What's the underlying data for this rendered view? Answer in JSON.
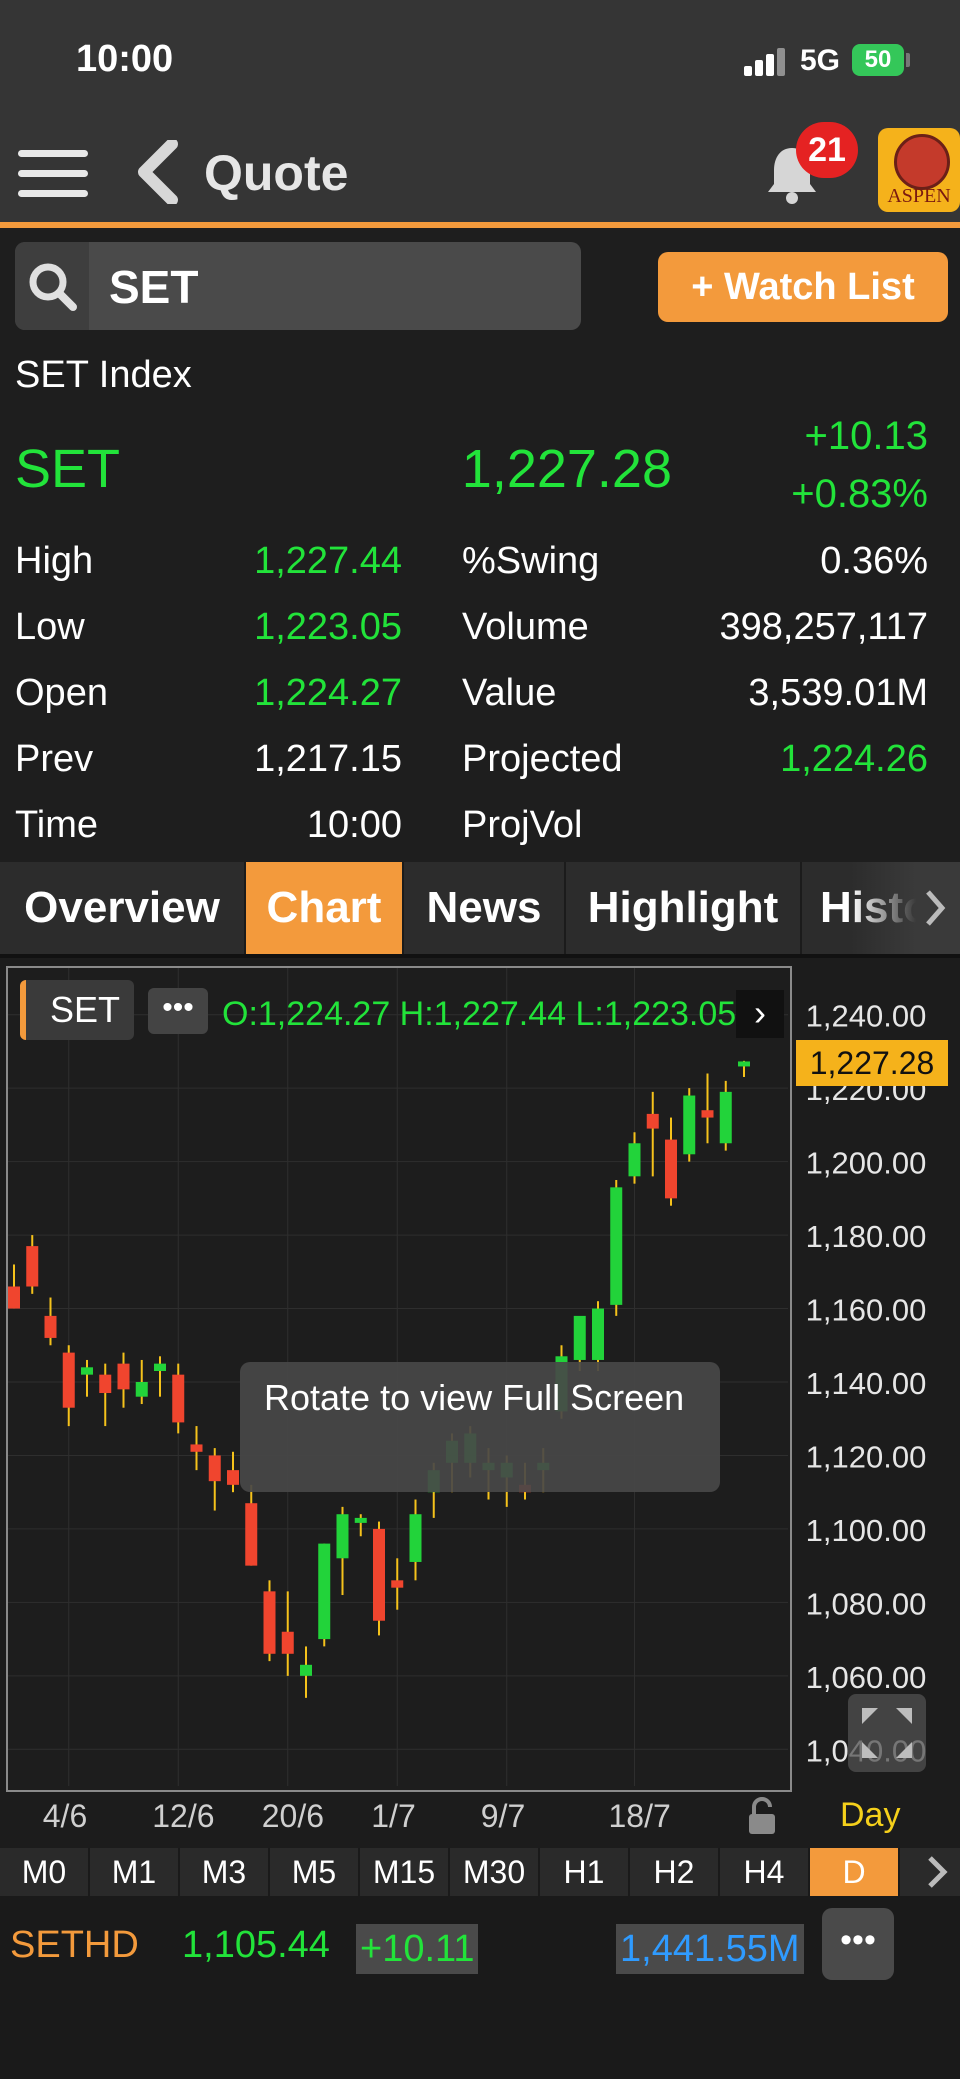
{
  "status_bar": {
    "time": "10:00",
    "network": "5G",
    "battery": "50"
  },
  "header": {
    "title": "Quote",
    "notification_count": "21",
    "logo_text": "ASPEN"
  },
  "search": {
    "value": "SET",
    "placeholder": ""
  },
  "watchlist_button": "+ Watch List",
  "quote": {
    "name": "SET Index",
    "symbol": "SET",
    "last": "1,227.28",
    "change": "+10.13",
    "change_pct": "+0.83%",
    "left_stats": [
      {
        "label": "High",
        "value": "1,227.44",
        "color": "green"
      },
      {
        "label": "Low",
        "value": "1,223.05",
        "color": "green"
      },
      {
        "label": "Open",
        "value": "1,224.27",
        "color": "green"
      },
      {
        "label": "Prev",
        "value": "1,217.15",
        "color": "white"
      },
      {
        "label": "Time",
        "value": "10:00",
        "color": "white"
      }
    ],
    "right_stats": [
      {
        "label": "%Swing",
        "value": "0.36%",
        "color": "white"
      },
      {
        "label": "Volume",
        "value": "398,257,117",
        "color": "white"
      },
      {
        "label": "Value",
        "value": "3,539.01M",
        "color": "white"
      },
      {
        "label": "Projected",
        "value": "1,224.26",
        "color": "green"
      },
      {
        "label": "ProjVol",
        "value": "",
        "color": "white"
      }
    ]
  },
  "tabs": [
    {
      "label": "Overview",
      "active": false
    },
    {
      "label": "Chart",
      "active": true
    },
    {
      "label": "News",
      "active": false
    },
    {
      "label": "Highlight",
      "active": false
    },
    {
      "label": "Histor",
      "active": false
    }
  ],
  "chart": {
    "symbol": "SET",
    "more_label": "•••",
    "ohlc_text": "O:1,224.27  H:1,227.44  L:1,223.05",
    "price_tag": "1,227.28",
    "tooltip": "Rotate to view Full Screen",
    "period_label": "Day",
    "colors": {
      "up": "#22d33a",
      "down": "#f0452e",
      "wick": "#f5c21b",
      "grid": "#2e2e2e"
    }
  },
  "chart_data": {
    "type": "candlestick",
    "title": "",
    "ylim": [
      1030,
      1250
    ],
    "y_ticks": [
      "1,240.00",
      "1,220.00",
      "1,200.00",
      "1,180.00",
      "1,160.00",
      "1,140.00",
      "1,120.00",
      "1,100.00",
      "1,080.00",
      "1,060.00",
      "1,040.00"
    ],
    "y_tick_values": [
      1240,
      1220,
      1200,
      1180,
      1160,
      1140,
      1120,
      1100,
      1080,
      1060,
      1040
    ],
    "x_ticks": [
      "4/6",
      "12/6",
      "20/6",
      "1/7",
      "9/7",
      "18/7"
    ],
    "x_tick_index": [
      3,
      9,
      15,
      21,
      27,
      34
    ],
    "last_value": 1227.28,
    "candles": [
      {
        "o": 1166,
        "h": 1172,
        "l": 1160,
        "c": 1160
      },
      {
        "o": 1177,
        "h": 1180,
        "l": 1164,
        "c": 1166
      },
      {
        "o": 1158,
        "h": 1163,
        "l": 1150,
        "c": 1152
      },
      {
        "o": 1148,
        "h": 1150,
        "l": 1128,
        "c": 1133
      },
      {
        "o": 1142,
        "h": 1146,
        "l": 1136,
        "c": 1144
      },
      {
        "o": 1142,
        "h": 1145,
        "l": 1128,
        "c": 1137
      },
      {
        "o": 1145,
        "h": 1148,
        "l": 1133,
        "c": 1138
      },
      {
        "o": 1136,
        "h": 1146,
        "l": 1134,
        "c": 1140
      },
      {
        "o": 1143,
        "h": 1147,
        "l": 1136,
        "c": 1145
      },
      {
        "o": 1142,
        "h": 1145,
        "l": 1126,
        "c": 1129
      },
      {
        "o": 1123,
        "h": 1128,
        "l": 1116,
        "c": 1121
      },
      {
        "o": 1120,
        "h": 1122,
        "l": 1105,
        "c": 1113
      },
      {
        "o": 1116,
        "h": 1121,
        "l": 1110,
        "c": 1112
      },
      {
        "o": 1107,
        "h": 1112,
        "l": 1090,
        "c": 1090
      },
      {
        "o": 1083,
        "h": 1086,
        "l": 1064,
        "c": 1066
      },
      {
        "o": 1072,
        "h": 1083,
        "l": 1060,
        "c": 1066
      },
      {
        "o": 1060,
        "h": 1068,
        "l": 1054,
        "c": 1063
      },
      {
        "o": 1070,
        "h": 1096,
        "l": 1068,
        "c": 1096
      },
      {
        "o": 1092,
        "h": 1106,
        "l": 1082,
        "c": 1104
      },
      {
        "o": 1102,
        "h": 1104,
        "l": 1098,
        "c": 1103
      },
      {
        "o": 1100,
        "h": 1102,
        "l": 1071,
        "c": 1075
      },
      {
        "o": 1086,
        "h": 1092,
        "l": 1078,
        "c": 1084
      },
      {
        "o": 1091,
        "h": 1108,
        "l": 1086,
        "c": 1104
      },
      {
        "o": 1110,
        "h": 1118,
        "l": 1103,
        "c": 1116
      },
      {
        "o": 1118,
        "h": 1126,
        "l": 1110,
        "c": 1124
      },
      {
        "o": 1118,
        "h": 1128,
        "l": 1114,
        "c": 1126
      },
      {
        "o": 1116,
        "h": 1122,
        "l": 1108,
        "c": 1118
      },
      {
        "o": 1114,
        "h": 1120,
        "l": 1106,
        "c": 1118
      },
      {
        "o": 1112,
        "h": 1118,
        "l": 1108,
        "c": 1110
      },
      {
        "o": 1116,
        "h": 1122,
        "l": 1110,
        "c": 1118
      },
      {
        "o": 1132,
        "h": 1150,
        "l": 1130,
        "c": 1147
      },
      {
        "o": 1146,
        "h": 1155,
        "l": 1143,
        "c": 1158
      },
      {
        "o": 1146,
        "h": 1162,
        "l": 1143,
        "c": 1160
      },
      {
        "o": 1161,
        "h": 1195,
        "l": 1158,
        "c": 1193
      },
      {
        "o": 1196,
        "h": 1208,
        "l": 1194,
        "c": 1205
      },
      {
        "o": 1213,
        "h": 1219,
        "l": 1196,
        "c": 1209
      },
      {
        "o": 1206,
        "h": 1212,
        "l": 1188,
        "c": 1190
      },
      {
        "o": 1202,
        "h": 1220,
        "l": 1200,
        "c": 1218
      },
      {
        "o": 1214,
        "h": 1224,
        "l": 1205,
        "c": 1212
      },
      {
        "o": 1205,
        "h": 1222,
        "l": 1203,
        "c": 1219
      },
      {
        "o": 1226,
        "h": 1227.44,
        "l": 1223.05,
        "c": 1227.28
      }
    ]
  },
  "timeframes": [
    {
      "label": "M0",
      "active": false
    },
    {
      "label": "M1",
      "active": false
    },
    {
      "label": "M3",
      "active": false
    },
    {
      "label": "M5",
      "active": false
    },
    {
      "label": "M15",
      "active": false
    },
    {
      "label": "M30",
      "active": false
    },
    {
      "label": "H1",
      "active": false
    },
    {
      "label": "H2",
      "active": false
    },
    {
      "label": "H4",
      "active": false
    },
    {
      "label": "D",
      "active": true
    }
  ],
  "ticker": {
    "symbol": "SETHD",
    "price": "1,105.44",
    "change": "+10.11",
    "value": "1,441.55M",
    "more_label": "•••"
  }
}
